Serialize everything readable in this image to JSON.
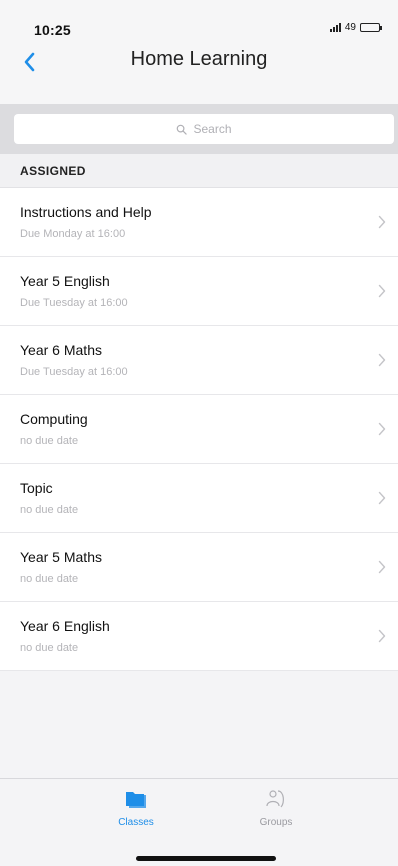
{
  "status_bar": {
    "time": "10:25",
    "battery_label": "49"
  },
  "nav": {
    "title": "Home Learning"
  },
  "search": {
    "placeholder": "Search"
  },
  "section": {
    "title": "ASSIGNED"
  },
  "items": [
    {
      "title": "Instructions and Help",
      "subtitle": "Due Monday at 16:00"
    },
    {
      "title": "Year 5 English",
      "subtitle": "Due Tuesday at 16:00"
    },
    {
      "title": "Year 6 Maths",
      "subtitle": "Due Tuesday at 16:00"
    },
    {
      "title": "Computing",
      "subtitle": "no due date"
    },
    {
      "title": "Topic",
      "subtitle": "no due date"
    },
    {
      "title": "Year 5 Maths",
      "subtitle": "no due date"
    },
    {
      "title": "Year 6 English",
      "subtitle": "no due date"
    }
  ],
  "tabs": [
    {
      "label": "Classes",
      "icon": "classes-folder-icon",
      "active": true
    },
    {
      "label": "Groups",
      "icon": "groups-icon",
      "active": false
    }
  ],
  "colors": {
    "accent": "#1f8ee8",
    "inactive": "#9a9aa0",
    "background": "#f4f4f6"
  }
}
